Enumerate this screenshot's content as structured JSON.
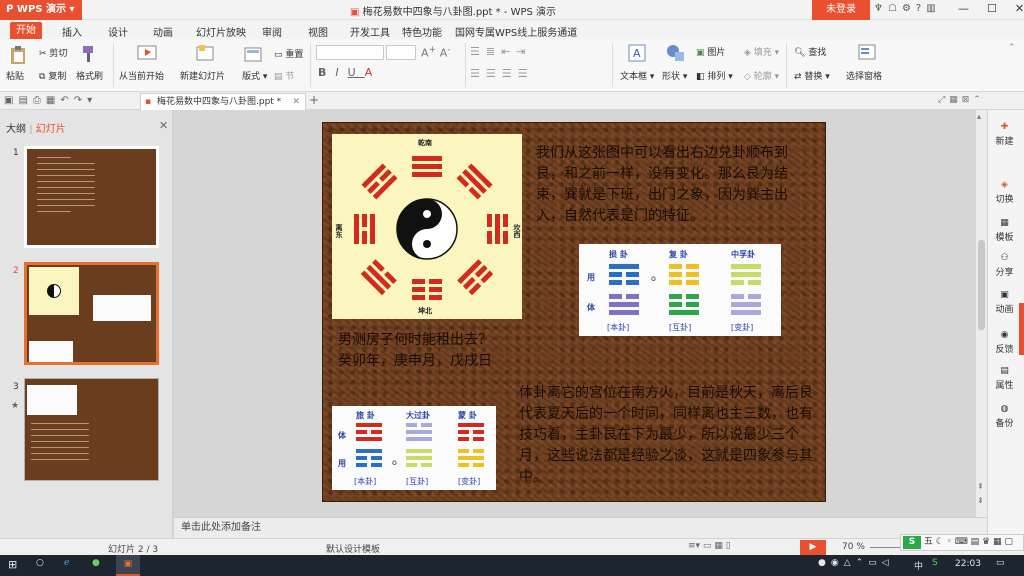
{
  "app": {
    "name": "WPS 演示",
    "window_title": "梅花易数中四象与八卦图.ppt * - WPS 演示",
    "login": "未登录"
  },
  "menu": [
    "开始",
    "插入",
    "设计",
    "动画",
    "幻灯片放映",
    "审阅",
    "视图",
    "开发工具",
    "特色功能",
    "国网专属WPS线上服务通道"
  ],
  "ribbon": {
    "paste": "粘贴",
    "cut": "剪切",
    "copy": "复制",
    "format_painter": "格式刷",
    "from_current": "从当前开始",
    "new_slide": "新建幻灯片",
    "layout": "版式",
    "reset": "重置",
    "section": "节",
    "textbox": "文本框",
    "shape": "形状",
    "picture": "图片",
    "arrange": "排列",
    "fill": "填充",
    "outline": "轮廓",
    "find": "查找",
    "replace": "替换",
    "select_pane": "选择窗格"
  },
  "doc_tab": "梅花易数中四象与八卦图.ppt *",
  "left_panel": {
    "outline_tab": "大纲",
    "slides_tab": "幻灯片",
    "numbers": [
      "1",
      "2",
      "3"
    ]
  },
  "slide": {
    "text_top": "我们从这张图中可以看出右边兑卦顺布到艮，和之前一样，没有变化。那么艮为结束，巽就是下班，出门之象，因为巽主出入，自然代表是门的特征。",
    "question_line1": "男测房子何时能租出去？",
    "question_line2": "癸卯年，庚申月，戊戌日",
    "text_bottom": "体卦离它的宫位在南方火，目前是秋天，离后艮代表夏天后的一个时间，同样离也主三数，也有技巧看，主卦艮在下为最少，所以说最少三个月，这些说法都是经验之谈，这就是四象参与其中。",
    "hex_top": {
      "titles": [
        "损 卦",
        "复 卦",
        "中孚卦"
      ],
      "labels": [
        "[本卦]",
        "[互卦]",
        "[变卦]"
      ],
      "left_labels": [
        "用",
        "体"
      ],
      "mid": "o"
    },
    "hex_bottom": {
      "titles": [
        "旅 卦",
        "大过卦",
        "蒙 卦"
      ],
      "labels": [
        "[本卦]",
        "[互卦]",
        "[变卦]"
      ],
      "left_labels": [
        "体",
        "用"
      ],
      "mid": "o"
    },
    "bagua_labels": {
      "top": "乾南",
      "bottom": "坤北",
      "left": "离东",
      "right": "坎西"
    }
  },
  "right_panel": [
    "新建",
    "切换",
    "模板",
    "分享",
    "动画",
    "反馈",
    "属性",
    "备份"
  ],
  "notes_placeholder": "单击此处添加备注",
  "status": {
    "slide_pos": "幻灯片 2 / 3",
    "template": "默认设计模板",
    "zoom": "70 %"
  },
  "taskbar": {
    "time": "22:03",
    "ime": "中"
  },
  "colors": {
    "accent": "#e8502f",
    "slide_bg": "#6b3b1c"
  }
}
